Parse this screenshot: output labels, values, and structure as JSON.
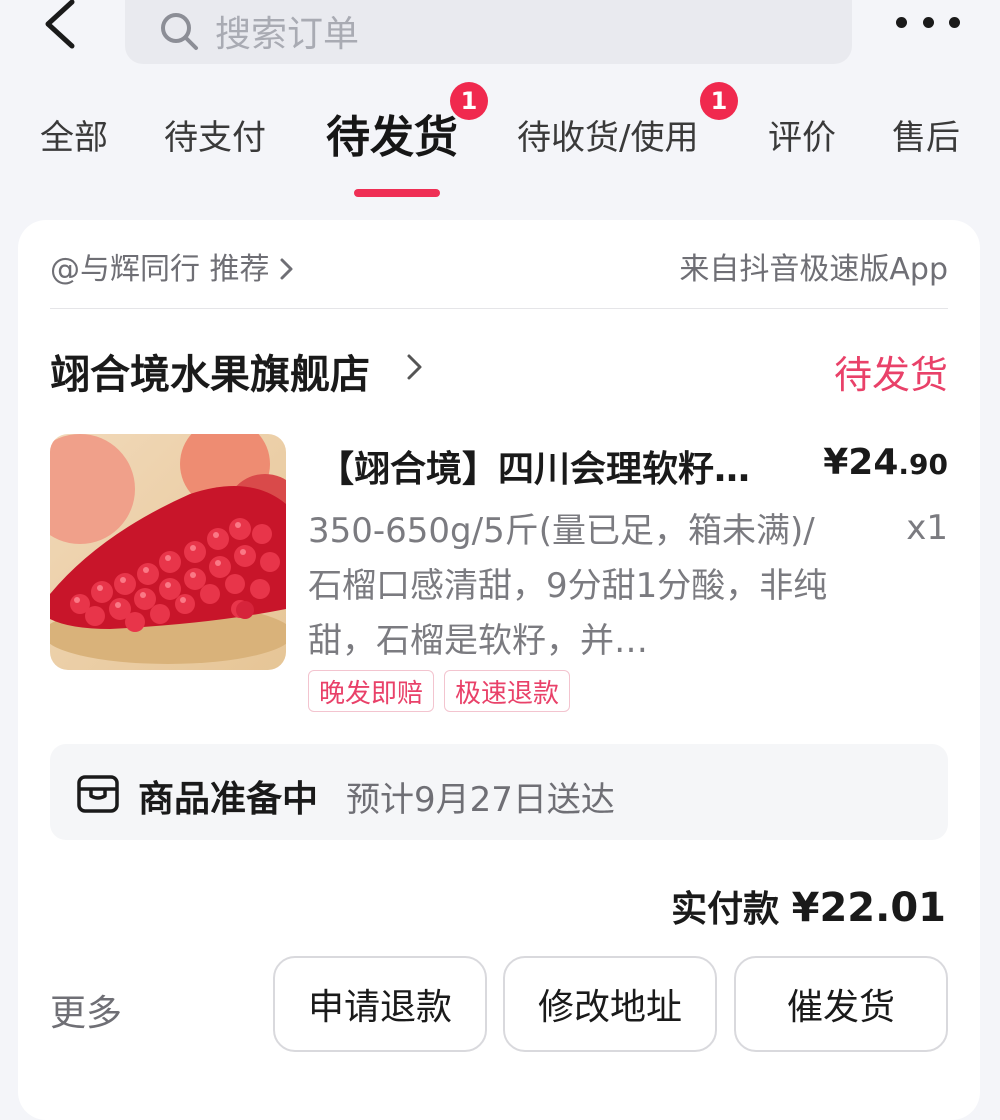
{
  "search": {
    "placeholder": "搜索订单"
  },
  "tabs": [
    {
      "label": "全部"
    },
    {
      "label": "待支付"
    },
    {
      "label": "待发货",
      "active": true,
      "badge": "1"
    },
    {
      "label": "待收货/使用",
      "badge": "1"
    },
    {
      "label": "评价"
    },
    {
      "label": "售后"
    }
  ],
  "order": {
    "via_left": "@与辉同行 推荐",
    "via_right": "来自抖音极速版App",
    "shop_name": "翊合境水果旗舰店",
    "status": "待发货",
    "product": {
      "title": "【翊合境】四川会理软籽石榴",
      "price_main": "¥24",
      "price_decimal": ".90",
      "spec": "350-650g/5斤(量已足，箱未满)/石榴口感清甜，9分甜1分酸，非纯甜，石榴是软籽，并…",
      "qty": "x1",
      "tags": [
        "晚发即赔",
        "极速退款"
      ]
    },
    "prep_title": "商品准备中",
    "prep_eta": "预计9月27日送达",
    "paid_label": "实付款",
    "paid_amount": "¥22.01",
    "more_label": "更多",
    "buttons": [
      "申请退款",
      "修改地址",
      "催发货"
    ]
  },
  "colors": {
    "accent": "#ef2f55",
    "status": "#e94169",
    "badge": "#f0294e"
  }
}
